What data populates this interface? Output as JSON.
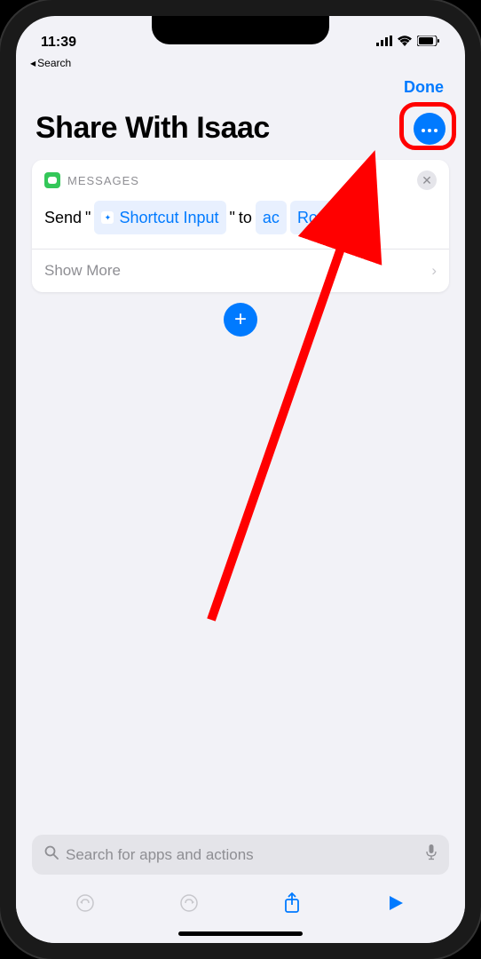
{
  "status": {
    "time": "11:39",
    "back_app": "Search"
  },
  "header": {
    "done": "Done",
    "title": "Share With Isaac"
  },
  "action": {
    "app_label": "MESSAGES",
    "verb": "Send",
    "quote_open": "\"",
    "input_token": "Shortcut Input",
    "quote_close": "\"",
    "connector": "to",
    "recipient_part1": "ac",
    "recipient_part2": "Roosa",
    "show_more": "Show More"
  },
  "search": {
    "placeholder": "Search for apps and actions"
  }
}
